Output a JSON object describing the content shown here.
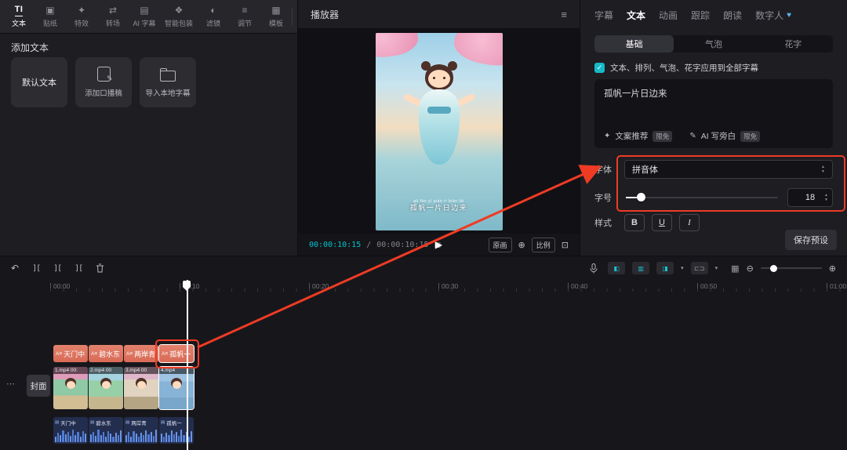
{
  "colors": {
    "accent": "#00c3cc",
    "annotation_red": "#ef3b24",
    "text_clip_orange": "#dd7460",
    "audio_clip_blue": "#232e4e"
  },
  "icons": {
    "text_tool": "TI",
    "sticker": "▣",
    "effects": "✦",
    "transition": "⇄",
    "ai_captions": "▤",
    "smart_package": "❖",
    "filter": "◐",
    "adjust": "≡",
    "template": "▦",
    "expand": "»",
    "menu": "≡",
    "frame_grid": "▦",
    "play": "▶",
    "fit": "⊕",
    "fullscreen": "⊡",
    "check": "✓",
    "up": "▲",
    "down": "▼",
    "caret": "▾",
    "ellipsis": "⋯",
    "heart": "♥",
    "sparkle": "✦",
    "pen": "✎",
    "undo": "↶",
    "split": "][",
    "zoom_out": "⊖",
    "zoom_in": "⊕",
    "audio_track": "▤",
    "subtitle_badge": "A≡",
    "snap": "◧",
    "link": "▥",
    "follow": "◨",
    "range": "⊏⊐",
    "keyboard": "▦"
  },
  "top_toolbar": {
    "items": [
      {
        "label": "文本"
      },
      {
        "label": "贴纸"
      },
      {
        "label": "特效"
      },
      {
        "label": "转场"
      },
      {
        "label": "AI 字幕"
      },
      {
        "label": "智能包装"
      },
      {
        "label": "滤镜"
      },
      {
        "label": "调节"
      },
      {
        "label": "模板"
      }
    ]
  },
  "media_panel": {
    "section_title": "添加文本",
    "cards": [
      {
        "label": "默认文本"
      },
      {
        "label": "添加口播稿"
      },
      {
        "label": "导入本地字幕"
      }
    ]
  },
  "player": {
    "title": "播放器",
    "current_time": "00:00:10:15",
    "time_separator": "/",
    "duration": "00:00:10:15",
    "original_label": "原画",
    "ratio_label": "比例",
    "subtitle_pinyin": "gū fān yī piàn rì biān lái",
    "subtitle_text": "孤帆一片日边来"
  },
  "inspector": {
    "tabs": [
      {
        "label": "字幕"
      },
      {
        "label": "文本"
      },
      {
        "label": "动画"
      },
      {
        "label": "跟踪"
      },
      {
        "label": "朗读"
      },
      {
        "label": "数字人"
      }
    ],
    "sub_tabs": [
      {
        "label": "基础"
      },
      {
        "label": "气泡"
      },
      {
        "label": "花字"
      }
    ],
    "apply_all_label": "文本、排列、气泡、花字应用到全部字幕",
    "text_value": "孤帆一片日边来",
    "suggest_label": "文案推荐",
    "ai_write_label": "AI 写旁白",
    "badge_label": "限免",
    "font_label": "字体",
    "font_value": "拼音体",
    "size_label": "字号",
    "size_value": "18",
    "style_label": "样式",
    "bold_label": "B",
    "underline_label": "U",
    "italic_label": "I",
    "save_preset_label": "保存预设"
  },
  "timeline": {
    "cover_label": "封面",
    "ruler": [
      {
        "label": "00:00"
      },
      {
        "label": "00:10"
      },
      {
        "label": "00:20"
      },
      {
        "label": "00:30"
      },
      {
        "label": "00:40"
      },
      {
        "label": "00:50"
      },
      {
        "label": "01:00"
      }
    ],
    "text_clips": [
      {
        "label": "天门中"
      },
      {
        "label": "碧水东"
      },
      {
        "label": "两岸青"
      },
      {
        "label": "孤帆一"
      }
    ],
    "video_clips": [
      {
        "label": "1.mp4 00:"
      },
      {
        "label": "2.mp4 00"
      },
      {
        "label": "3.mp4 00"
      },
      {
        "label": "4.mp4"
      }
    ],
    "audio_clips": [
      {
        "label": "天门中"
      },
      {
        "label": "碧水东"
      },
      {
        "label": "两岸青"
      },
      {
        "label": "孤帆一"
      }
    ]
  }
}
